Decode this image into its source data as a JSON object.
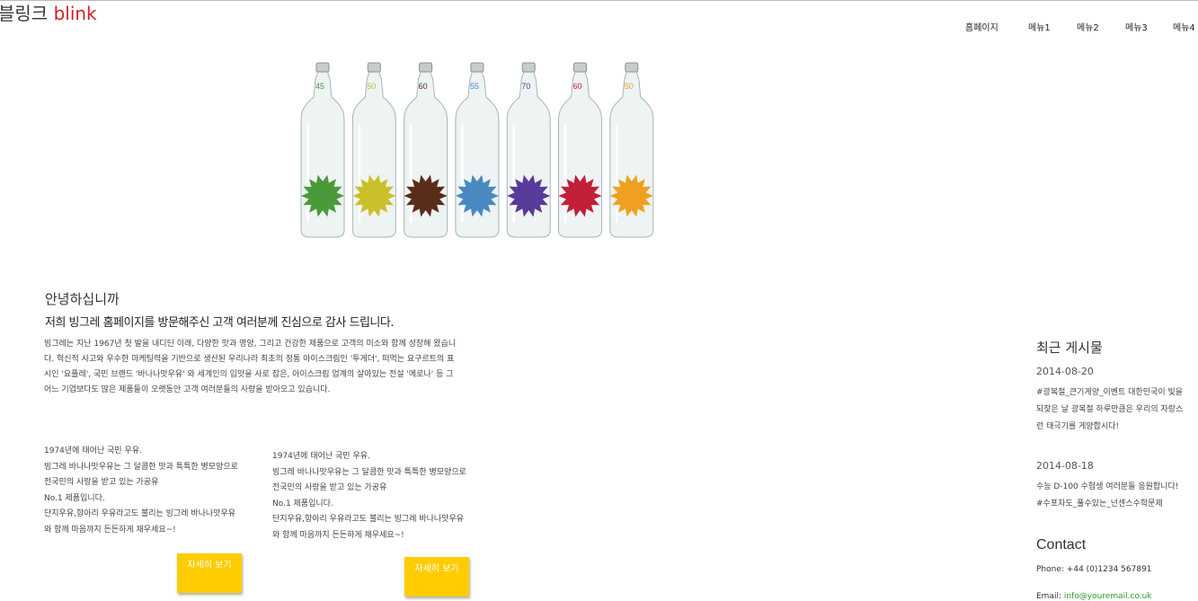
{
  "logo": {
    "prefix": "블링크",
    "accent": "blink"
  },
  "nav": [
    "홈페이지",
    "메뉴1",
    "메뉴2",
    "메뉴3",
    "메뉴4"
  ],
  "hero": {
    "bottles": [
      {
        "number": "45",
        "label_color": "#4a9a3a"
      },
      {
        "number": "50",
        "label_color": "#c9c02a"
      },
      {
        "number": "60",
        "label_color": "#5a2d1a"
      },
      {
        "number": "55",
        "label_color": "#4a8ac0"
      },
      {
        "number": "70",
        "label_color": "#5a3a9a"
      },
      {
        "number": "60",
        "label_color": "#c21f3a"
      },
      {
        "number": "50",
        "label_color": "#f0a020"
      }
    ]
  },
  "main": {
    "greeting": "안녕하십니까",
    "subgreeting": "저희 빙그레 홈페이지를 방문해주신 고객 여러분께 진심으로 감사 드립니다.",
    "intro": "빙그레는 지난 1967년 첫 발을 내디딘 이래, 다양한 맛과 영양, 그리고 건강한 제품으로 고객의 미소와 함께 성장해 왔습니다. 혁신적 사고와 우수한 마케팅력을 기반으로 생산된 우리나라 최초의 정통 아이스크림인 '투게더', 떠먹는 요구르트의 표시인 '요플레', 국민 브랜드 '바나나맛우유' 와 세계인의 입맛을 사로 잡은, 아이스크림 업계의 살아있는 전설 '메로나' 등 그 어느 기업보다도 많은 제품들이 오랫동안 고객 여러분들의 사랑을 받아오고 있습니다.",
    "columns": [
      {
        "text": "1974년에 태어난 국민 우유.\n빙그레 바나나맛우유는 그 달콤한 맛과 특특한 병모양으로 전국민의 사랑을 받고 있는 가공유\nNo.1 제품입니다.\n단지우유,항아리 우유라고도 불리는 빙그레 바나나맛우유와 함께 마음까지 든든하게 채우세요~!",
        "button": "자세히 보기"
      },
      {
        "text": "1974년에 태어난 국민 우유.\n빙그레 바나나맛우유는 그 달콤한 맛과 특특한 병모양으로 전국민의 사랑을 받고 있는 가공유\nNo.1 제품입니다.\n단지우유,항아리 우유라고도 불리는 빙그레 바나나맛우유와 함께 마음까지 든든하게 채우세요~!",
        "button": "자세히 보기"
      }
    ]
  },
  "sidebar": {
    "recent_title": "최근 게시물",
    "posts": [
      {
        "date": "2014-08-20",
        "text": "#광복절_큰기게양_이벤트 대한민국이 빛을 되찾은 날 광복절 하루만큼은 우리의 자랑스런 태극기를 게양합시다!"
      },
      {
        "date": "2014-08-18",
        "text": "수능 D-100 수험생 여러분들 응원합니다! #수포자도_풀수있는_넌센스수학문제"
      }
    ],
    "contact_title": "Contact",
    "phone_label": "Phone:",
    "phone": "+44 (0)1234 567891",
    "email_label": "Email:",
    "email": "info@youremail.co.uk"
  }
}
